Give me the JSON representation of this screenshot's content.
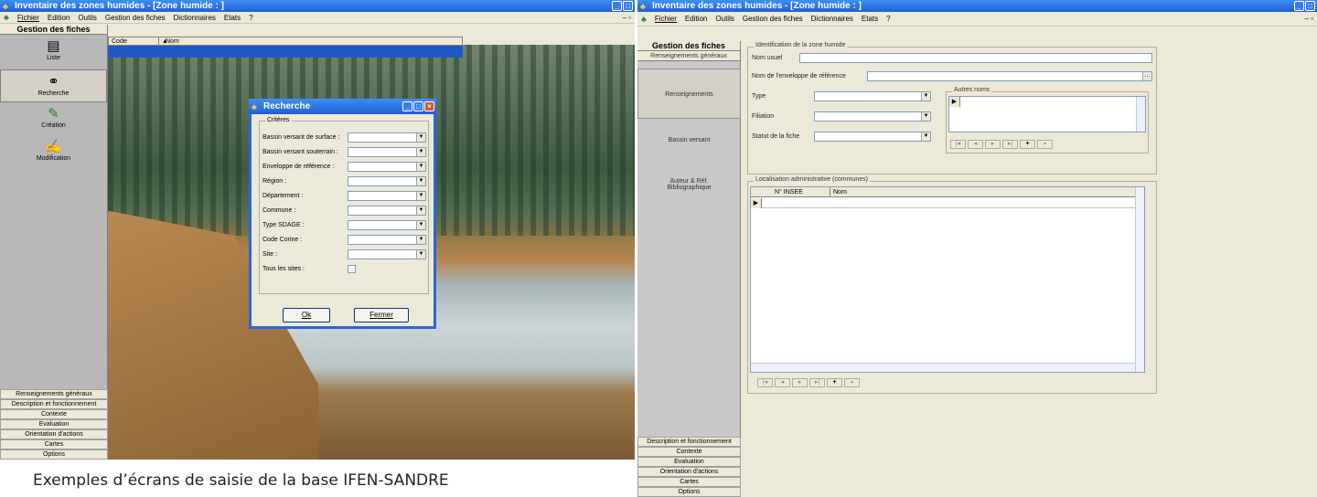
{
  "win1": {
    "title": "Inventaire des zones humides - [Zone humide : ]",
    "menu": [
      "Fichier",
      "Edition",
      "Outils",
      "Gestion des fiches",
      "Dictionnaires",
      "Etats",
      "?"
    ],
    "sidebar_header": "Gestion des fiches",
    "sidebar_items": [
      {
        "label": "Liste",
        "icon": "list-icon"
      },
      {
        "label": "Recherche",
        "icon": "binoculars-icon"
      },
      {
        "label": "Création",
        "icon": "create-icon"
      },
      {
        "label": "Modification",
        "icon": "edit-icon"
      }
    ],
    "bottom_nav": [
      "Renseignements généraux",
      "Description et fonctionnement",
      "Contexte",
      "Evaluation",
      "Orientation d'actions",
      "Cartes",
      "Options"
    ],
    "grid_columns": [
      "Code",
      "Nom"
    ]
  },
  "dialog": {
    "title": "Recherche",
    "legend": "Critères",
    "criteria": [
      "Bassin versant de surface :",
      "Bassin versant souterrain :",
      "Enveloppe de référence :",
      "Région :",
      "Département :",
      "Commune :",
      "Type SDAGE :",
      "Code Corine :",
      "Site :"
    ],
    "all_sites_label": "Tous les sites :",
    "ok_label": "Ok",
    "close_label": "Fermer"
  },
  "win2": {
    "title": "Inventaire des zones humides - [Zone humide : ]",
    "menu": [
      "Fichier",
      "Edition",
      "Outils",
      "Gestion des fiches",
      "Dictionnaires",
      "Etats",
      "?"
    ],
    "sidebar_header": "Gestion des fiches",
    "sidebar_tab": "Renseignements généraux",
    "sections": [
      "Renseignements",
      "Bassin versant",
      "Auteur & Réf. Bibliographique"
    ],
    "bottom_nav": [
      "Description et fonctionnement",
      "Contexte",
      "Evaluation",
      "Orientation d'actions",
      "Cartes",
      "Options"
    ],
    "identification_legend": "Identification de la zone humide",
    "nom_usuel_label": "Nom usuel",
    "enveloppe_label": "Nom de l'enveloppe de référence",
    "type_label": "Type",
    "filiation_label": "Filiation",
    "statut_label": "Statut de la fiche",
    "autres_noms_legend": "Autres noms",
    "localisation_legend": "Localisation administrative (communes)",
    "table_columns": [
      "N° INSEE",
      "Nom"
    ]
  },
  "caption": "Exemples d’écrans de saisie de la base IFEN-SANDRE"
}
